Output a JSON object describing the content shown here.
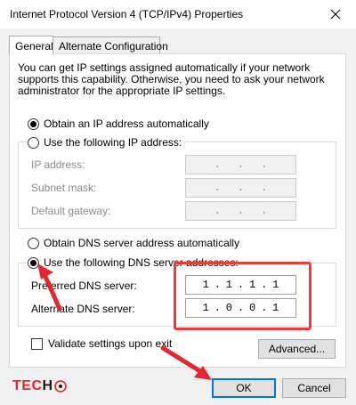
{
  "window": {
    "title": "Internet Protocol Version 4 (TCP/IPv4) Properties",
    "close_glyph": "✕"
  },
  "tabs": [
    {
      "label": "General",
      "active": true
    },
    {
      "label": "Alternate Configuration",
      "active": false
    }
  ],
  "description": "You can get IP settings assigned automatically if your network supports this capability. Otherwise, you need to ask your network administrator for the appropriate IP settings.",
  "ip_section": {
    "auto_label": "Obtain an IP address automatically",
    "manual_label": "Use the following IP address:",
    "selected": "auto",
    "fields": [
      {
        "label": "IP address:",
        "value": [
          " ",
          " ",
          " ",
          " "
        ]
      },
      {
        "label": "Subnet mask:",
        "value": [
          " ",
          " ",
          " ",
          " "
        ]
      },
      {
        "label": "Default gateway:",
        "value": [
          " ",
          " ",
          " ",
          " "
        ]
      }
    ]
  },
  "dns_section": {
    "auto_label": "Obtain DNS server address automatically",
    "manual_label": "Use the following DNS server addresses:",
    "selected": "manual",
    "preferred_label": "Preferred DNS server:",
    "preferred_value": [
      "1",
      "1",
      "1",
      "1"
    ],
    "alternate_label": "Alternate DNS server:",
    "alternate_value": [
      "1",
      "0",
      "0",
      "1"
    ]
  },
  "validate": {
    "label": "Validate settings upon exit",
    "checked": false
  },
  "buttons": {
    "advanced": "Advanced...",
    "ok": "OK",
    "cancel": "Cancel"
  },
  "logo": {
    "text_red": "TEC",
    "text_dark": "H"
  },
  "colors": {
    "highlight": "#ef3a3a",
    "focus_blue": "#0078d7"
  }
}
